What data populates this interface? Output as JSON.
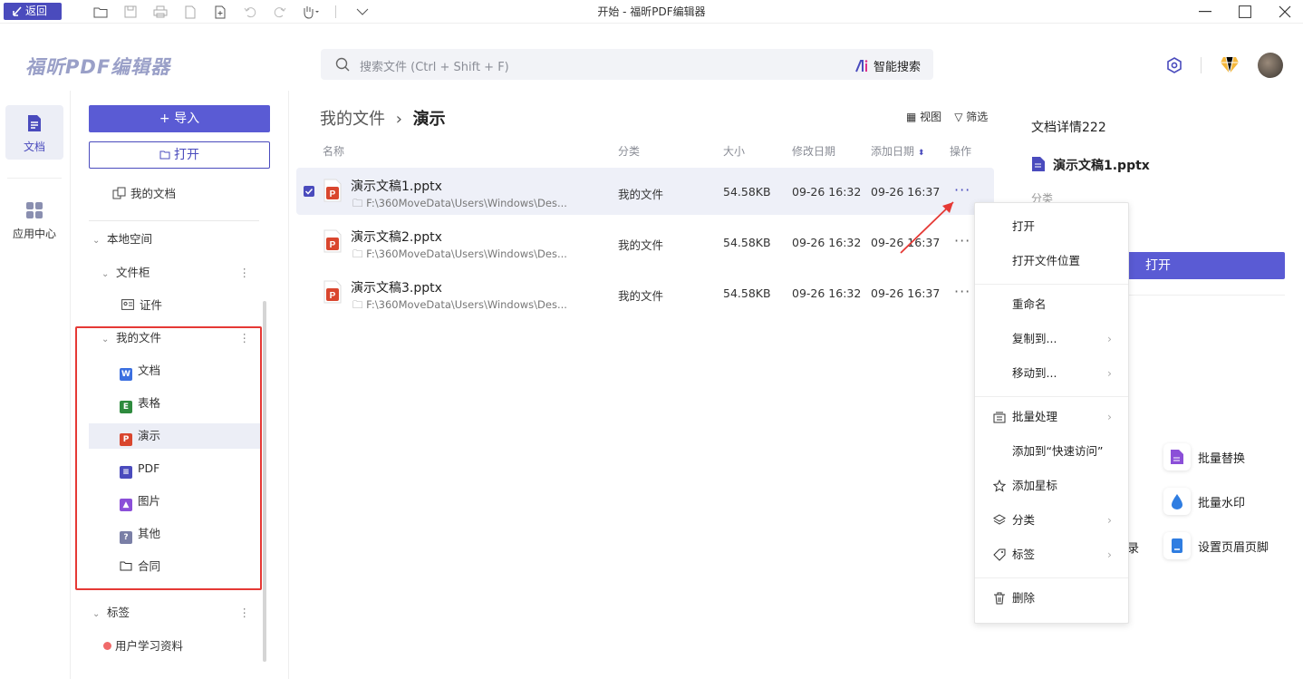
{
  "titlebar": {
    "back_label": "返回",
    "window_title": "开始 - 福昕PDF编辑器"
  },
  "app": {
    "logo": "福昕PDF编辑器"
  },
  "search": {
    "placeholder": "搜索文件 (Ctrl + Shift + F)",
    "ai_label": "智能搜索"
  },
  "nav": {
    "docs_label": "文档",
    "apps_label": "应用中心"
  },
  "sidebar": {
    "import_label": "+ 导入",
    "open_label": "打开",
    "my_docs": "我的文档",
    "local_space": "本地空间",
    "cabinet": "文件柜",
    "certificate": "证件",
    "my_files": "我的文件",
    "types": [
      {
        "label": "文档",
        "color": "#3b6fe0",
        "glyph": "W"
      },
      {
        "label": "表格",
        "color": "#2e8b3e",
        "glyph": "E"
      },
      {
        "label": "演示",
        "color": "#d9462e",
        "glyph": "P"
      },
      {
        "label": "PDF",
        "color": "#4a4bbd",
        "glyph": "≡"
      },
      {
        "label": "图片",
        "color": "#8b4fd8",
        "glyph": "▲"
      },
      {
        "label": "其他",
        "color": "#7a7fa6",
        "glyph": "?"
      },
      {
        "label": "合同",
        "color": "#333333",
        "glyph": ""
      }
    ],
    "tags": "标签",
    "tag_item": "用户学习资料"
  },
  "breadcrumb": {
    "parent": "我的文件",
    "current": "演示"
  },
  "toolbar": {
    "view": "视图",
    "filter": "筛选"
  },
  "table": {
    "headers": {
      "name": "名称",
      "category": "分类",
      "size": "大小",
      "modified": "修改日期",
      "added": "添加日期",
      "actions": "操作"
    },
    "rows": [
      {
        "name": "演示文稿1.pptx",
        "path": "F:\\360MoveData\\Users\\Windows\\Des...",
        "category": "我的文件",
        "size": "54.58KB",
        "modified": "09-26 16:32",
        "added": "09-26 16:37"
      },
      {
        "name": "演示文稿2.pptx",
        "path": "F:\\360MoveData\\Users\\Windows\\Des...",
        "category": "我的文件",
        "size": "54.58KB",
        "modified": "09-26 16:32",
        "added": "09-26 16:37"
      },
      {
        "name": "演示文稿3.pptx",
        "path": "F:\\360MoveData\\Users\\Windows\\Des...",
        "category": "我的文件",
        "size": "54.58KB",
        "modified": "09-26 16:32",
        "added": "09-26 16:37"
      }
    ]
  },
  "details": {
    "title": "文档详情222",
    "file": "演示文稿1.pptx",
    "category_label": "分类",
    "open": "打开",
    "tools": [
      "批量替换",
      "批量水印",
      "设置页眉页脚"
    ],
    "partial": "录"
  },
  "context_menu": {
    "open": "打开",
    "open_location": "打开文件位置",
    "rename": "重命名",
    "copy_to": "复制到...",
    "move_to": "移动到...",
    "batch": "批量处理",
    "add_quick": "添加到“快速访问”",
    "add_star": "添加星标",
    "classify": "分类",
    "tag": "标签",
    "delete": "删除"
  }
}
